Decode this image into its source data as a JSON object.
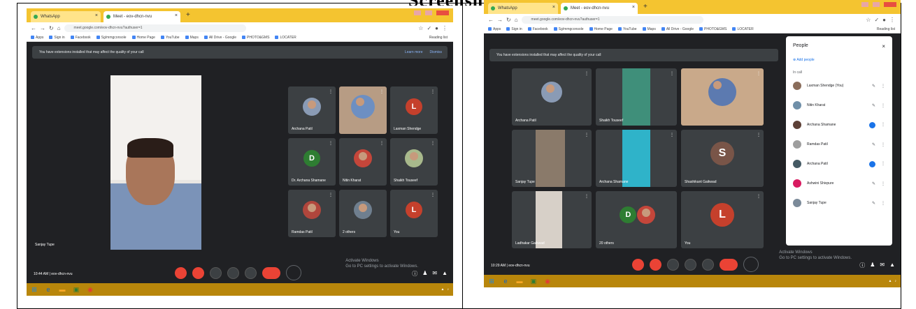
{
  "doc": {
    "title": "Screenshots"
  },
  "colors": {
    "meet_bg": "#202124",
    "tile_bg": "#3c4043",
    "end_call": "#ea4335",
    "taskbar": "#b8860b",
    "chrome_tabs": "#f4c430"
  },
  "shot1": {
    "tabs": [
      {
        "label": "WhatsApp"
      },
      {
        "label": "Meet - eov-dhcn-nvu"
      }
    ],
    "url": "meet.google.com/eov-dhcn-nvu?authuser=1",
    "bookmarks": [
      "Apps",
      "Sign in",
      "Facebook",
      "Sg/mmgconsole",
      "Home Page",
      "YouTube",
      "Maps",
      "All Drive - Google",
      "PHOTO&GMS",
      "LOCATER"
    ],
    "reading_list": "Reading list",
    "banner": {
      "text": "You have extensions installed that may affect the quality of your call",
      "learn_more": "Learn more",
      "dismiss": "Dismiss"
    },
    "presenter_name": "Sanjay Tupe",
    "tiles": [
      {
        "name": "Archana Patil",
        "kind": "photo"
      },
      {
        "name": "",
        "kind": "video"
      },
      {
        "name": "Laxman Shendge",
        "kind": "letter",
        "letter": "L",
        "color": "#c5402c"
      },
      {
        "name": "Dr. Archana Shamane",
        "kind": "letter",
        "letter": "D",
        "color": "#2e7d32"
      },
      {
        "name": "Nitin Kharat",
        "kind": "photo"
      },
      {
        "name": "Shaikh Touseef",
        "kind": "photo"
      },
      {
        "name": "Ramdas Patil",
        "kind": "photo"
      },
      {
        "name": "2 others",
        "kind": "photo"
      },
      {
        "name": "You",
        "kind": "letter",
        "letter": "L",
        "color": "#c5402c"
      }
    ],
    "time": "10:44 AM",
    "meeting_code": "eov-dhcn-nvu",
    "activate": [
      "Activate Windows",
      "Go to PC settings to activate Windows."
    ]
  },
  "shot2": {
    "tabs": [
      {
        "label": "WhatsApp"
      },
      {
        "label": "Meet - eov-dhcn-nvu"
      }
    ],
    "url": "meet.google.com/eov-dhcn-nvu?authuser=1",
    "bookmarks": [
      "Apps",
      "Sign in",
      "Facebook",
      "Sg/mmgconsole",
      "Home Page",
      "YouTube",
      "Maps",
      "All Drive - Google",
      "PHOTO&GMS",
      "LOCATER"
    ],
    "reading_list": "Reading list",
    "banner": {
      "text": "You have extensions installed that may affect the quality of your call"
    },
    "tiles": [
      {
        "name": "Archana Patil",
        "kind": "photo"
      },
      {
        "name": "Shaikh Touseef",
        "kind": "video"
      },
      {
        "name": "",
        "kind": "video"
      },
      {
        "name": "Sanjay Tupe",
        "kind": "video"
      },
      {
        "name": "Archana Shamane",
        "kind": "video"
      },
      {
        "name": "Shashikant Gaikwad",
        "kind": "letter",
        "letter": "S",
        "color": "#795548"
      },
      {
        "name": "Ladhakar Gaikwad",
        "kind": "video"
      },
      {
        "name": "20 others",
        "kind": "photo"
      },
      {
        "name": "You",
        "kind": "letter",
        "letter": "L",
        "color": "#c5402c"
      }
    ],
    "people": {
      "title": "People",
      "add": "Add people",
      "in_call": "In call",
      "list": [
        {
          "name": "Laxman Shendge (You)"
        },
        {
          "name": "Nitin Kharat"
        },
        {
          "name": "Archana Shamane"
        },
        {
          "name": "Ramdas Patil"
        },
        {
          "name": "Archana Patil"
        },
        {
          "name": "Ashwini Shivpure"
        },
        {
          "name": "Sanjay Tupe"
        }
      ]
    },
    "time": "10:29 AM",
    "meeting_code": "eov-dhcn-nvu",
    "activate": [
      "Activate Windows",
      "Go to PC settings to activate Windows."
    ]
  }
}
